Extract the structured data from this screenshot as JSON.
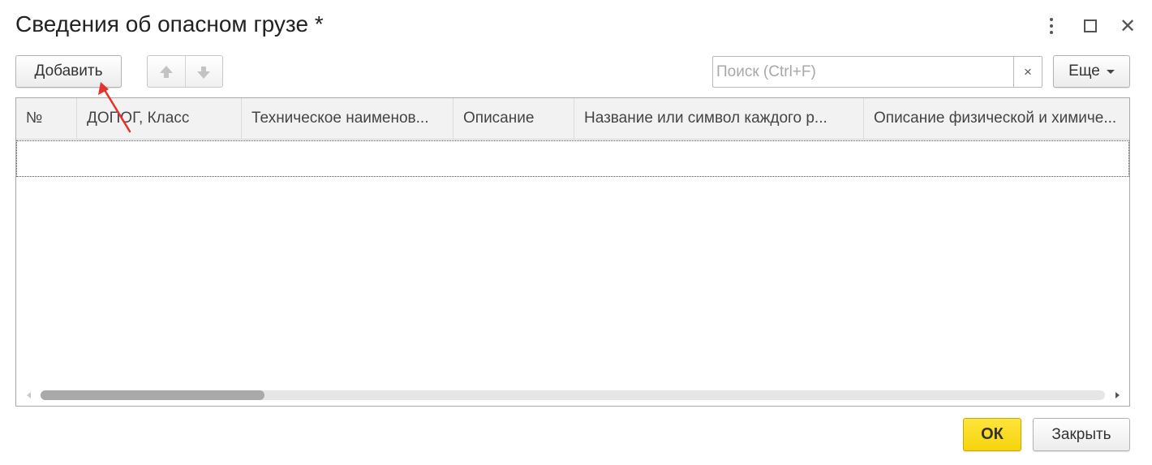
{
  "window": {
    "title": "Сведения об опасном грузе *",
    "more_icon": "vertical-dots-icon",
    "maximize_icon": "maximize-icon",
    "close_icon": "close-icon",
    "close_glyph": "✕"
  },
  "toolbar": {
    "add_label": "Добавить",
    "move_up_icon": "arrow-up-icon",
    "move_down_icon": "arrow-down-icon",
    "search_placeholder": "Поиск (Ctrl+F)",
    "search_value": "",
    "search_clear_glyph": "×",
    "more_label": "Еще"
  },
  "table": {
    "columns": [
      "№",
      "ДОПОГ, Класс",
      "Техническое наименов...",
      "Описание",
      "Название или символ каждого р...",
      "Описание физической и химиче..."
    ],
    "rows": [],
    "horizontal_scroll_fraction": 0.21
  },
  "footer": {
    "ok_label": "ОК",
    "close_label": "Закрыть"
  },
  "colors": {
    "ok_button": "#f5d40c",
    "annotation_arrow": "#e5322d"
  }
}
